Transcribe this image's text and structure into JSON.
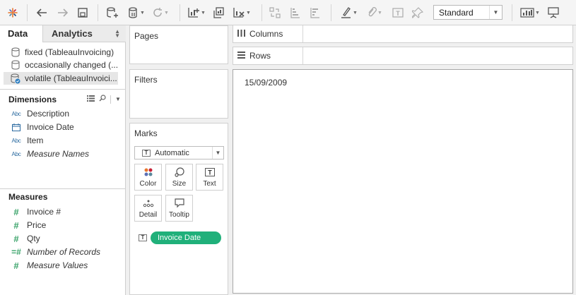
{
  "toolbar": {
    "fit_mode": "Standard",
    "icons": [
      "tableau-logo-icon",
      "undo-icon",
      "redo-icon",
      "save-icon",
      "new-datasource-icon",
      "pause-updates-icon",
      "refresh-icon",
      "new-worksheet-icon",
      "duplicate-sheet-icon",
      "clear-sheet-icon",
      "swap-icon",
      "sort-ascending-icon",
      "sort-descending-icon",
      "highlight-icon",
      "group-icon",
      "show-labels-icon",
      "fix-axes-icon",
      "show-me-icon",
      "presentation-icon"
    ]
  },
  "left_panel": {
    "tabs": [
      {
        "label": "Data",
        "active": true
      },
      {
        "label": "Analytics",
        "active": false
      }
    ],
    "datasources": [
      {
        "label": "fixed (TableauInvoicing)",
        "selected": false
      },
      {
        "label": "occasionally changed (...",
        "selected": false
      },
      {
        "label": "volatile (TableauInvoici...",
        "selected": true
      }
    ],
    "dimensions_title": "Dimensions",
    "dimensions": [
      {
        "label": "Description",
        "type": "Abc",
        "italic": false
      },
      {
        "label": "Invoice Date",
        "type": "date",
        "italic": false
      },
      {
        "label": "Item",
        "type": "Abc",
        "italic": false
      },
      {
        "label": "Measure Names",
        "type": "Abc",
        "italic": true
      }
    ],
    "measures_title": "Measures",
    "measures": [
      {
        "label": "Invoice #",
        "type": "#",
        "italic": false
      },
      {
        "label": "Price",
        "type": "#",
        "italic": false
      },
      {
        "label": "Qty",
        "type": "#",
        "italic": false
      },
      {
        "label": "Number of Records",
        "type": "=#",
        "italic": true
      },
      {
        "label": "Measure Values",
        "type": "#",
        "italic": true
      }
    ]
  },
  "cards": {
    "pages_title": "Pages",
    "filters_title": "Filters",
    "marks_title": "Marks",
    "marks_type": "Automatic",
    "marks_buttons": [
      {
        "label": "Color"
      },
      {
        "label": "Size"
      },
      {
        "label": "Text"
      },
      {
        "label": "Detail"
      },
      {
        "label": "Tooltip"
      }
    ],
    "marks_pill": "Invoice Date",
    "marks_pill_color": "#20b07a"
  },
  "shelves": {
    "columns_label": "Columns",
    "rows_label": "Rows"
  },
  "view": {
    "value": "15/09/2009"
  }
}
